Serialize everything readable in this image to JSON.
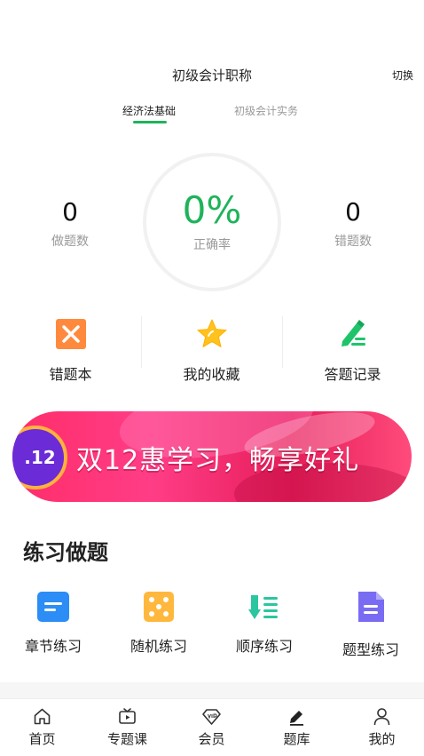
{
  "header": {
    "title": "初级会计职称",
    "switch_label": "切换"
  },
  "tabs": [
    {
      "label": "经济法基础",
      "active": true
    },
    {
      "label": "初级会计实务",
      "active": false
    }
  ],
  "stats": {
    "done": {
      "value": "0",
      "label": "做题数"
    },
    "accuracy": {
      "value": "0%",
      "label": "正确率"
    },
    "wrong": {
      "value": "0",
      "label": "错题数"
    }
  },
  "quick_actions": [
    {
      "label": "错题本",
      "icon": "wrong-book-icon",
      "color": "#ff8a3d"
    },
    {
      "label": "我的收藏",
      "icon": "star-icon",
      "color": "#ffc21e"
    },
    {
      "label": "答题记录",
      "icon": "edit-record-icon",
      "color": "#1fc46a"
    }
  ],
  "banner": {
    "badge": ".12",
    "text": "双12惠学习，畅享好礼"
  },
  "section": {
    "title": "练习做题"
  },
  "practice": [
    {
      "label": "章节练习",
      "icon": "chapter-icon",
      "color": "#2b8df5"
    },
    {
      "label": "随机练习",
      "icon": "dice-icon",
      "color": "#ffb83d"
    },
    {
      "label": "顺序练习",
      "icon": "sequence-icon",
      "color": "#2bc6a0"
    },
    {
      "label": "题型练习",
      "icon": "document-icon",
      "color": "#7a6cf2"
    }
  ],
  "nav": [
    {
      "label": "首页",
      "icon": "home-icon"
    },
    {
      "label": "专题课",
      "icon": "video-icon"
    },
    {
      "label": "会员",
      "icon": "vip-icon"
    },
    {
      "label": "题库",
      "icon": "question-bank-icon"
    },
    {
      "label": "我的",
      "icon": "user-icon"
    }
  ],
  "colors": {
    "accent": "#1fb35b",
    "banner": "#ff2d6a"
  }
}
